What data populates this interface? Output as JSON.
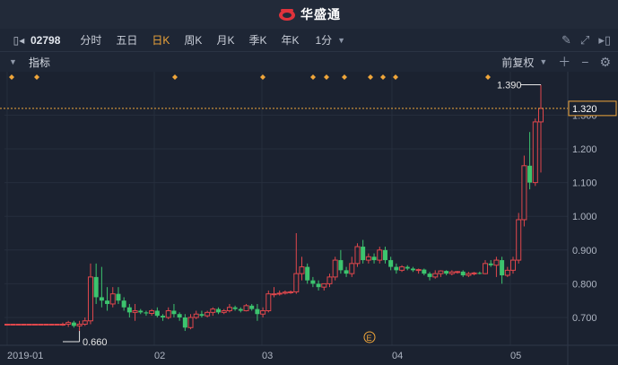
{
  "app": {
    "brand": "华盛通"
  },
  "toolbar": {
    "stock_code": "02798",
    "periods": [
      "分时",
      "五日",
      "日K",
      "周K",
      "月K",
      "季K",
      "年K"
    ],
    "active_period": "日K",
    "interval": "1分"
  },
  "indicator_bar": {
    "label": "指标",
    "adjust": "前复权"
  },
  "colors": {
    "up": "#e0474c",
    "down": "#3cc46e",
    "background": "#1b2230",
    "accent": "#f0a63a"
  },
  "chart_data": {
    "type": "candlestick",
    "x_ticks": [
      "2019-01",
      "02",
      "03",
      "04",
      "05"
    ],
    "y_ticks": [
      "1.300",
      "1.200",
      "1.100",
      "1.000",
      "0.900",
      "0.800",
      "0.700"
    ],
    "ylim": [
      0.64,
      1.43
    ],
    "current_price": "1.320",
    "max_label": "1.390",
    "min_label": "0.660",
    "event_marker": "E",
    "candles": [
      [
        0.68,
        0.68,
        0.68,
        0.68
      ],
      [
        0.68,
        0.68,
        0.68,
        0.68
      ],
      [
        0.68,
        0.68,
        0.68,
        0.68
      ],
      [
        0.68,
        0.681,
        0.679,
        0.68
      ],
      [
        0.68,
        0.681,
        0.679,
        0.68
      ],
      [
        0.68,
        0.68,
        0.68,
        0.68
      ],
      [
        0.68,
        0.681,
        0.678,
        0.68
      ],
      [
        0.68,
        0.68,
        0.68,
        0.68
      ],
      [
        0.68,
        0.681,
        0.679,
        0.68
      ],
      [
        0.68,
        0.681,
        0.679,
        0.68
      ],
      [
        0.68,
        0.685,
        0.675,
        0.68
      ],
      [
        0.68,
        0.69,
        0.672,
        0.685
      ],
      [
        0.685,
        0.69,
        0.67,
        0.675
      ],
      [
        0.675,
        0.69,
        0.66,
        0.68
      ],
      [
        0.68,
        0.7,
        0.675,
        0.69
      ],
      [
        0.69,
        0.86,
        0.68,
        0.82
      ],
      [
        0.82,
        0.86,
        0.74,
        0.76
      ],
      [
        0.76,
        0.85,
        0.73,
        0.75
      ],
      [
        0.75,
        0.79,
        0.72,
        0.74
      ],
      [
        0.74,
        0.79,
        0.73,
        0.77
      ],
      [
        0.77,
        0.79,
        0.74,
        0.75
      ],
      [
        0.75,
        0.76,
        0.72,
        0.73
      ],
      [
        0.73,
        0.74,
        0.7,
        0.715
      ],
      [
        0.715,
        0.74,
        0.69,
        0.72
      ],
      [
        0.72,
        0.725,
        0.71,
        0.715
      ],
      [
        0.715,
        0.72,
        0.705,
        0.712
      ],
      [
        0.712,
        0.725,
        0.705,
        0.72
      ],
      [
        0.72,
        0.73,
        0.7,
        0.705
      ],
      [
        0.705,
        0.71,
        0.69,
        0.7
      ],
      [
        0.7,
        0.73,
        0.695,
        0.72
      ],
      [
        0.72,
        0.74,
        0.7,
        0.71
      ],
      [
        0.71,
        0.715,
        0.69,
        0.7
      ],
      [
        0.7,
        0.71,
        0.66,
        0.67
      ],
      [
        0.67,
        0.71,
        0.665,
        0.7
      ],
      [
        0.7,
        0.72,
        0.695,
        0.71
      ],
      [
        0.71,
        0.72,
        0.7,
        0.705
      ],
      [
        0.705,
        0.72,
        0.7,
        0.715
      ],
      [
        0.715,
        0.73,
        0.705,
        0.725
      ],
      [
        0.725,
        0.73,
        0.71,
        0.715
      ],
      [
        0.715,
        0.725,
        0.71,
        0.72
      ],
      [
        0.72,
        0.74,
        0.715,
        0.73
      ],
      [
        0.73,
        0.735,
        0.72,
        0.725
      ],
      [
        0.725,
        0.73,
        0.715,
        0.72
      ],
      [
        0.72,
        0.74,
        0.718,
        0.735
      ],
      [
        0.735,
        0.74,
        0.72,
        0.725
      ],
      [
        0.725,
        0.74,
        0.69,
        0.71
      ],
      [
        0.71,
        0.73,
        0.7,
        0.72
      ],
      [
        0.72,
        0.78,
        0.715,
        0.77
      ],
      [
        0.77,
        0.79,
        0.76,
        0.77
      ],
      [
        0.77,
        0.78,
        0.765,
        0.772
      ],
      [
        0.772,
        0.78,
        0.768,
        0.775
      ],
      [
        0.775,
        0.78,
        0.77,
        0.776
      ],
      [
        0.776,
        0.95,
        0.77,
        0.83
      ],
      [
        0.83,
        0.88,
        0.81,
        0.85
      ],
      [
        0.85,
        0.86,
        0.8,
        0.81
      ],
      [
        0.81,
        0.82,
        0.79,
        0.8
      ],
      [
        0.8,
        0.81,
        0.78,
        0.79
      ],
      [
        0.79,
        0.8,
        0.78,
        0.8
      ],
      [
        0.8,
        0.83,
        0.79,
        0.82
      ],
      [
        0.82,
        0.88,
        0.81,
        0.87
      ],
      [
        0.87,
        0.9,
        0.83,
        0.84
      ],
      [
        0.84,
        0.85,
        0.82,
        0.83
      ],
      [
        0.83,
        0.88,
        0.82,
        0.86
      ],
      [
        0.86,
        0.92,
        0.85,
        0.91
      ],
      [
        0.91,
        0.93,
        0.86,
        0.87
      ],
      [
        0.87,
        0.89,
        0.86,
        0.88
      ],
      [
        0.88,
        0.89,
        0.86,
        0.87
      ],
      [
        0.87,
        0.91,
        0.86,
        0.9
      ],
      [
        0.9,
        0.91,
        0.86,
        0.87
      ],
      [
        0.87,
        0.88,
        0.84,
        0.85
      ],
      [
        0.85,
        0.86,
        0.83,
        0.84
      ],
      [
        0.84,
        0.855,
        0.835,
        0.85
      ],
      [
        0.85,
        0.855,
        0.84,
        0.845
      ],
      [
        0.845,
        0.85,
        0.835,
        0.84
      ],
      [
        0.84,
        0.845,
        0.83,
        0.842
      ],
      [
        0.842,
        0.845,
        0.825,
        0.83
      ],
      [
        0.83,
        0.835,
        0.81,
        0.82
      ],
      [
        0.82,
        0.84,
        0.815,
        0.83
      ],
      [
        0.83,
        0.84,
        0.82,
        0.838
      ],
      [
        0.838,
        0.84,
        0.825,
        0.83
      ],
      [
        0.83,
        0.84,
        0.825,
        0.835
      ],
      [
        0.835,
        0.838,
        0.83,
        0.836
      ],
      [
        0.836,
        0.84,
        0.82,
        0.825
      ],
      [
        0.825,
        0.835,
        0.82,
        0.83
      ],
      [
        0.83,
        0.835,
        0.825,
        0.832
      ],
      [
        0.832,
        0.836,
        0.828,
        0.83
      ],
      [
        0.83,
        0.87,
        0.828,
        0.86
      ],
      [
        0.86,
        0.87,
        0.85,
        0.855
      ],
      [
        0.855,
        0.88,
        0.82,
        0.87
      ],
      [
        0.87,
        0.88,
        0.8,
        0.825
      ],
      [
        0.825,
        0.85,
        0.82,
        0.84
      ],
      [
        0.84,
        0.88,
        0.83,
        0.87
      ],
      [
        0.87,
        1.01,
        0.86,
        0.99
      ],
      [
        0.99,
        1.18,
        0.97,
        1.15
      ],
      [
        1.15,
        1.25,
        1.08,
        1.1
      ],
      [
        1.1,
        1.29,
        1.09,
        1.28
      ],
      [
        1.28,
        1.39,
        1.13,
        1.32
      ]
    ]
  }
}
